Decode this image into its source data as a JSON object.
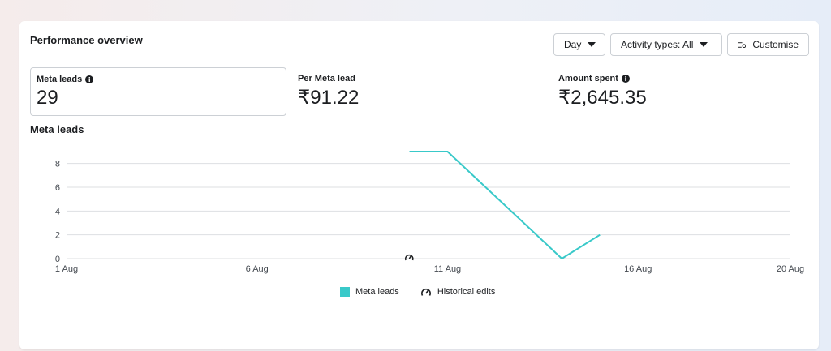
{
  "card": {
    "title": "Performance overview"
  },
  "controls": {
    "day_label": "Day",
    "activity_label": "Activity types: All",
    "customise_label": "Customise"
  },
  "metrics": [
    {
      "label": "Meta leads",
      "value": "29",
      "has_info": true
    },
    {
      "label": "Per Meta lead",
      "value": "₹91.22",
      "has_info": false
    },
    {
      "label": "Amount spent",
      "value": "₹2,645.35",
      "has_info": true
    }
  ],
  "section_title": "Meta leads",
  "legend": {
    "series_label": "Meta leads",
    "edits_label": "Historical edits"
  },
  "colors": {
    "series": "#39c9c9",
    "grid": "#dddfe2",
    "axis_text": "#444950"
  },
  "chart_data": {
    "type": "line",
    "title": "Meta leads",
    "xlabel": "",
    "ylabel": "",
    "x_ticks": [
      "1 Aug",
      "6 Aug",
      "11 Aug",
      "16 Aug",
      "20 Aug"
    ],
    "x_tick_days": [
      1,
      6,
      11,
      16,
      20
    ],
    "y_ticks": [
      0,
      2,
      4,
      6,
      8
    ],
    "xlim": [
      1,
      20
    ],
    "ylim": [
      0,
      9
    ],
    "grid": true,
    "legend_position": "bottom",
    "series": [
      {
        "name": "Meta leads",
        "x": [
          "10 Aug",
          "11 Aug",
          "14 Aug",
          "15 Aug"
        ],
        "x_days": [
          10,
          11,
          14,
          15
        ],
        "values": [
          9,
          9,
          0,
          2
        ]
      }
    ],
    "annotations": [
      {
        "type": "historical-edit",
        "x_day": 10,
        "label": "Historical edits"
      }
    ]
  }
}
